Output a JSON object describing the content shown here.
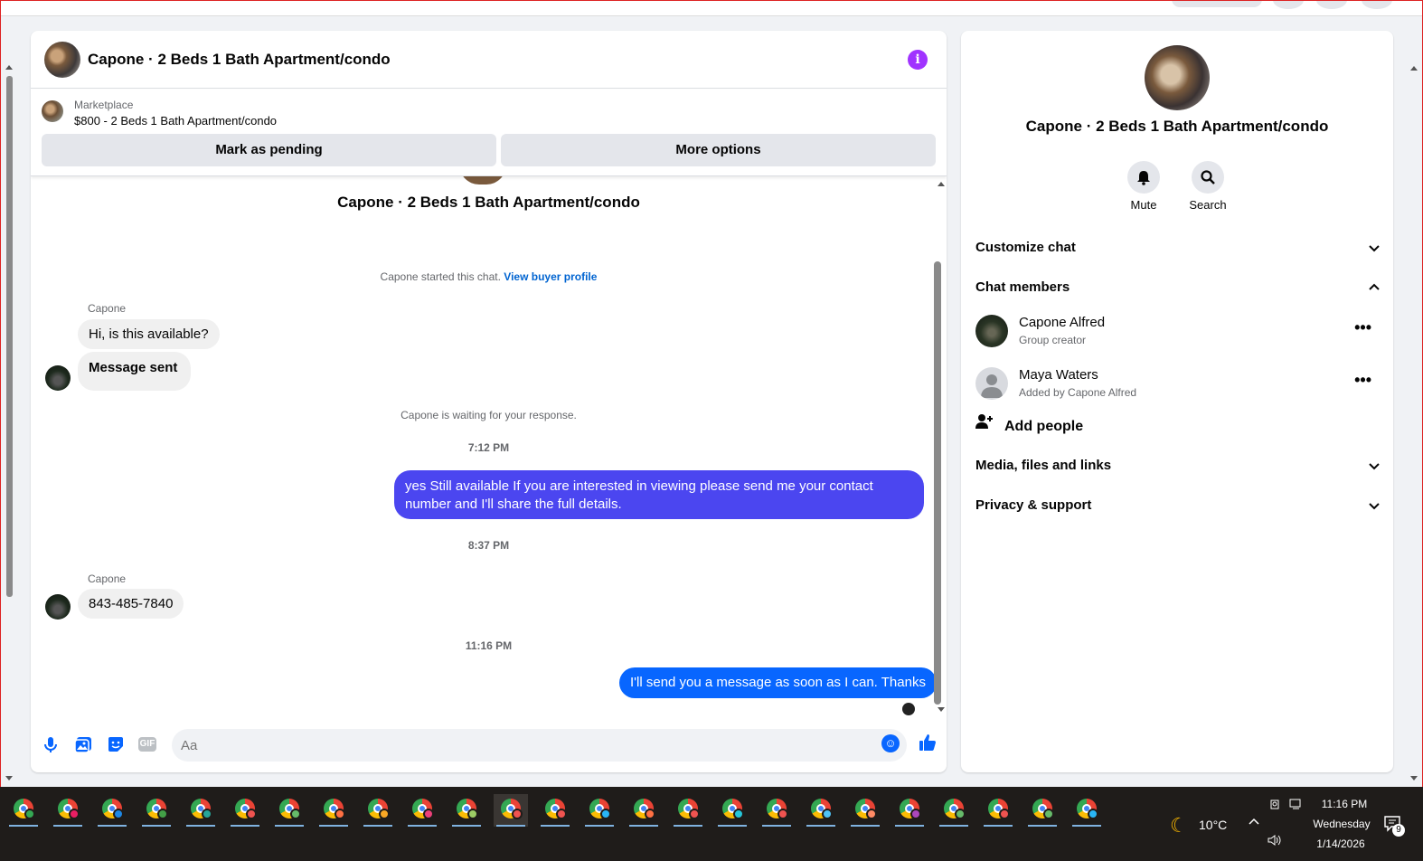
{
  "chat": {
    "title": "Capone · 2 Beds 1 Bath Apartment/condo",
    "marketplace_label": "Marketplace",
    "listing": "$800 - 2 Beds 1 Bath Apartment/condo",
    "mark_pending_label": "Mark as pending",
    "more_options_label": "More options",
    "center_title": "Capone · 2 Beds 1 Bath Apartment/condo",
    "started_text": "Capone started this chat.",
    "view_profile_link": "View buyer profile",
    "waiting_text": "Capone is waiting for your response.",
    "messages": [
      {
        "sender": "Capone",
        "text": "Hi, is this available?"
      },
      {
        "text": "Message sent"
      },
      {
        "time": "7:12 PM"
      },
      {
        "text": "yes Still available If you are interested in viewing please send me your contact number and I'll share the full details."
      },
      {
        "time": "8:37 PM"
      },
      {
        "sender": "Capone",
        "text": "843-485-7840"
      },
      {
        "time": "11:16 PM"
      },
      {
        "text": "I'll send you a message as soon as I can. Thanks"
      }
    ],
    "composer_placeholder": "Aa",
    "gif_label": "GIF"
  },
  "info": {
    "title": "Capone · 2 Beds 1 Bath Apartment/condo",
    "mute_label": "Mute",
    "search_label": "Search",
    "customize_chat": "Customize chat",
    "chat_members": "Chat members",
    "members": [
      {
        "name": "Capone Alfred",
        "role": "Group creator"
      },
      {
        "name": "Maya Waters",
        "role": "Added by Capone Alfred"
      }
    ],
    "add_people": "Add people",
    "media_files": "Media, files and links",
    "privacy": "Privacy & support"
  },
  "taskbar": {
    "temperature": "10°C",
    "time": "11:16 PM",
    "day": "Wednesday",
    "date": "1/14/2026",
    "notification_count": "9"
  },
  "colors": {
    "accent": "#0866ff",
    "outgoing_purple": "#4b46f0",
    "info_icon": "#a033ff"
  }
}
